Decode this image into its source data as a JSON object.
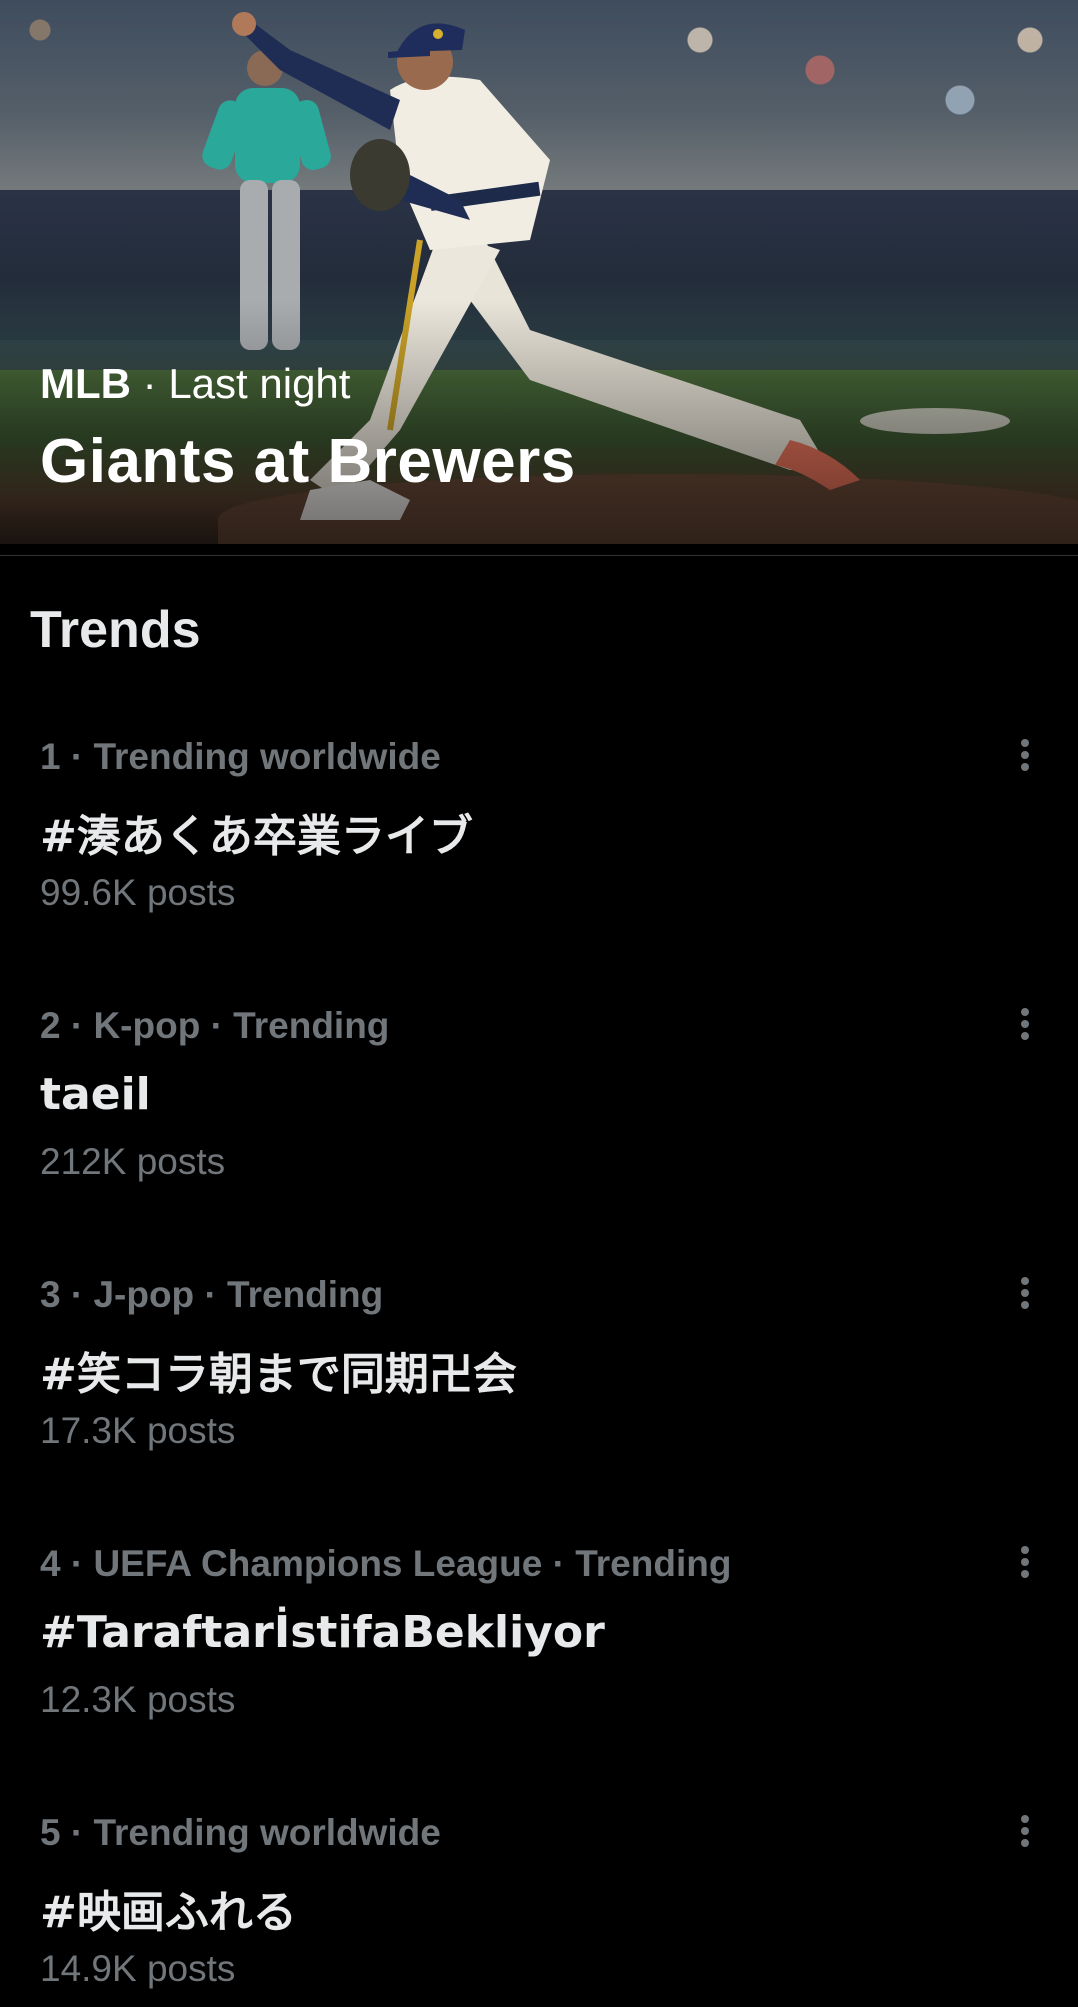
{
  "hero": {
    "league": "MLB",
    "separator": "·",
    "time": "Last night",
    "title": "Giants at Brewers"
  },
  "trends": {
    "heading": "Trends",
    "items": [
      {
        "context": "1 · Trending worldwide",
        "name": "#湊あくあ卒業ライブ",
        "count": "99.6K posts"
      },
      {
        "context": "2 · K-pop · Trending",
        "name": "taeil",
        "count": "212K posts"
      },
      {
        "context": "3 · J-pop · Trending",
        "name": "#笑コラ朝まで同期卍会",
        "count": "17.3K posts"
      },
      {
        "context": "4 · UEFA Champions League · Trending",
        "name": "#Taraftarİstifa­Bekliyor",
        "count": "12.3K posts"
      },
      {
        "context": "5 · Trending worldwide",
        "name": "#映画ふれる",
        "count": "14.9K posts"
      }
    ]
  },
  "icons": {
    "more": "more-vertical-icon"
  },
  "colors": {
    "background": "#000000",
    "primary_text": "#e7e9ea",
    "secondary_text": "#71767b",
    "divider": "#2f3336"
  }
}
